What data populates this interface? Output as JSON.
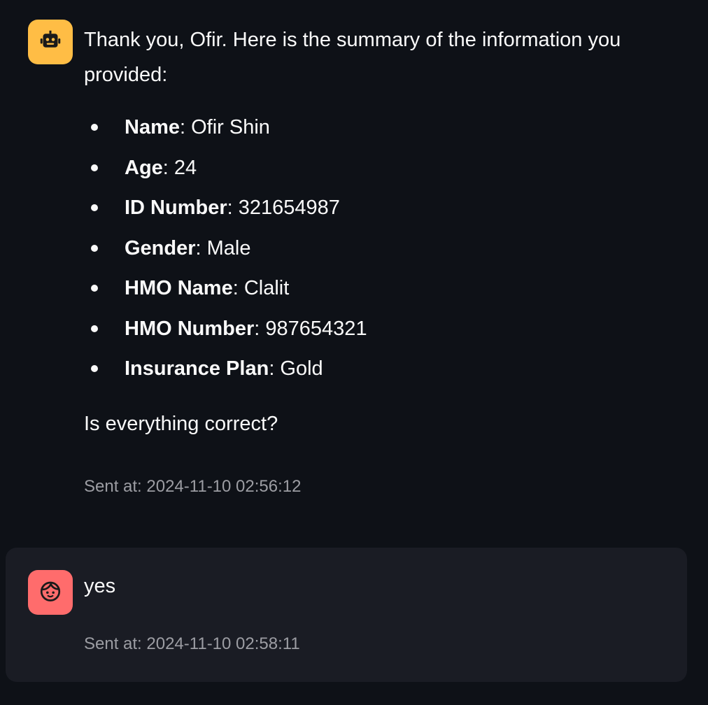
{
  "assistant_message": {
    "intro": "Thank you, Ofir. Here is the summary of the information you provided:",
    "fields": [
      {
        "label": "Name",
        "value": ": Ofir Shin"
      },
      {
        "label": "Age",
        "value": ": 24"
      },
      {
        "label": "ID Number",
        "value": ": 321654987"
      },
      {
        "label": "Gender",
        "value": ": Male"
      },
      {
        "label": "HMO Name",
        "value": ": Clalit"
      },
      {
        "label": "HMO Number",
        "value": ": 987654321"
      },
      {
        "label": "Insurance Plan",
        "value": ": Gold"
      }
    ],
    "question": "Is everything correct?",
    "timestamp": "Sent at: 2024-11-10 02:56:12",
    "avatar_icon": "robot-icon",
    "avatar_color": "#ffbd45"
  },
  "user_message": {
    "text": "yes",
    "timestamp": "Sent at: 2024-11-10 02:58:11",
    "avatar_icon": "face-icon",
    "avatar_color": "#ff6c6c"
  },
  "colors": {
    "background": "#0e1117",
    "user_bubble": "#1a1c24",
    "text": "#fafafa",
    "timestamp": "#9c9da3"
  }
}
